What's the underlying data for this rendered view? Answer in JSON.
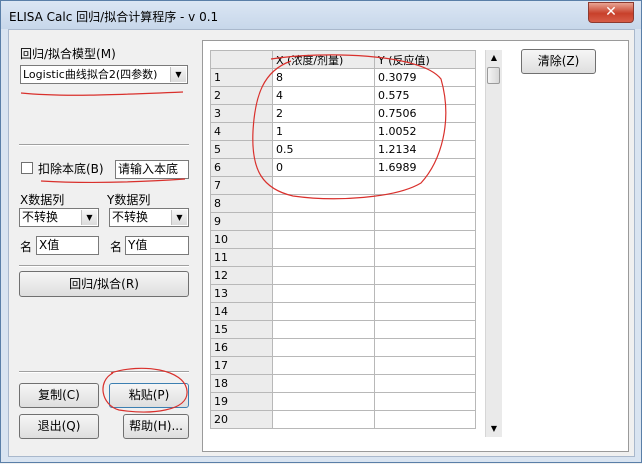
{
  "window": {
    "title": "ELISA Calc 回归/拟合计算程序 - v 0.1",
    "close_glyph": "✕"
  },
  "model": {
    "label": "回归/拟合模型(M)",
    "value": "Logistic曲线拟合2(四参数)"
  },
  "background": {
    "checkbox_label": "扣除本底(B)",
    "input_value": "请输入本底"
  },
  "xcol": {
    "label": "X数据列",
    "value": "不转换",
    "name_label": "名",
    "name_value": "X值"
  },
  "ycol": {
    "label": "Y数据列",
    "value": "不转换",
    "name_label": "名",
    "name_value": "Y值"
  },
  "buttons": {
    "fit": "回归/拟合(R)",
    "copy": "复制(C)",
    "paste": "粘贴(P)",
    "exit": "退出(Q)",
    "help": "帮助(H)...",
    "clear": "清除(Z)"
  },
  "grid": {
    "headers": [
      "",
      "X (浓度/剂量)",
      "Y (反应值)"
    ],
    "rows": [
      {
        "n": "1",
        "x": "8",
        "y": "0.3079"
      },
      {
        "n": "2",
        "x": "4",
        "y": "0.575"
      },
      {
        "n": "3",
        "x": "2",
        "y": "0.7506"
      },
      {
        "n": "4",
        "x": "1",
        "y": "1.0052"
      },
      {
        "n": "5",
        "x": "0.5",
        "y": "1.2134"
      },
      {
        "n": "6",
        "x": "0",
        "y": "1.6989"
      },
      {
        "n": "7",
        "x": "",
        "y": ""
      },
      {
        "n": "8",
        "x": "",
        "y": ""
      },
      {
        "n": "9",
        "x": "",
        "y": ""
      },
      {
        "n": "10",
        "x": "",
        "y": ""
      },
      {
        "n": "11",
        "x": "",
        "y": ""
      },
      {
        "n": "12",
        "x": "",
        "y": ""
      },
      {
        "n": "13",
        "x": "",
        "y": ""
      },
      {
        "n": "14",
        "x": "",
        "y": ""
      },
      {
        "n": "15",
        "x": "",
        "y": ""
      },
      {
        "n": "16",
        "x": "",
        "y": ""
      },
      {
        "n": "17",
        "x": "",
        "y": ""
      },
      {
        "n": "18",
        "x": "",
        "y": ""
      },
      {
        "n": "19",
        "x": "",
        "y": ""
      },
      {
        "n": "20",
        "x": "",
        "y": ""
      }
    ]
  },
  "annotation_color": "#d9302c"
}
